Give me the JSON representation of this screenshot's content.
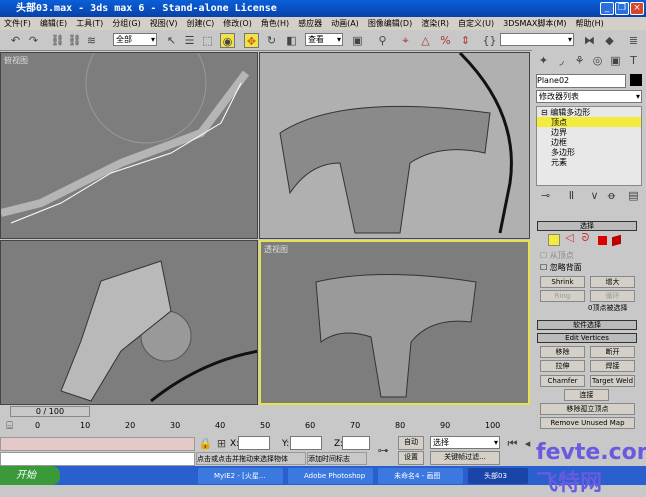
{
  "window": {
    "title": "头部03.max - 3ds max 6 - Stand-alone License"
  },
  "menu": [
    "文件(F)",
    "编辑(E)",
    "工具(T)",
    "分组(G)",
    "视图(V)",
    "创建(C)",
    "修改(O)",
    "角色(H)",
    "感应器",
    "动画(A)",
    "图像编辑(D)",
    "渲染(R)",
    "自定义(U)",
    "3DSMAX脚本(M)",
    "帮助(H)"
  ],
  "toolbar": {
    "selection_filter": "全部",
    "coord_system": "查看",
    "named_selection": ""
  },
  "viewports": {
    "top_left": "俯视图",
    "bottom_right": "透视图"
  },
  "panel": {
    "object_name": "Plane02",
    "modifier_list": "修改器列表",
    "stack": [
      "编辑多边形",
      "顶点",
      "边界",
      "边框",
      "多边形",
      "元素"
    ],
    "selection_rollout": "选择",
    "by_vertex": "从顶点",
    "ignore_backfacing": "忽略背面",
    "shrink": "Shrink",
    "grow": "增大",
    "ring": "Ring",
    "loop": "循环",
    "selected_count": "0顶点被选择",
    "soft_selection": "软件选择",
    "edit_vertices": "Edit Vertices",
    "remove": "移除",
    "break": "断开",
    "extrude": "拉伸",
    "weld": "焊接",
    "chamfer": "Chamfer",
    "target_weld": "Target Weld",
    "connect": "连接",
    "remove_isolated": "移除孤立顶点",
    "remove_unused": "Remove Unused Map Verts"
  },
  "timeline": {
    "frame": "0 / 100",
    "ticks": [
      "0",
      "10",
      "20",
      "30",
      "40",
      "50",
      "60",
      "70",
      "80",
      "90",
      "100"
    ]
  },
  "status": {
    "x_label": "X:",
    "y_label": "Y:",
    "z_label": "Z:",
    "auto_key": "自动",
    "set_key": "设置",
    "key_mode": "选择",
    "key_filters": "关键帧过滤...",
    "prompt": "点击或点击并拖动来选择物体",
    "add_time_tag": "添加时间标志"
  },
  "taskbar": {
    "start": "开始",
    "items": [
      "MyIE2 - [火星...",
      "Adobe Photoshop",
      "未命名4 - 画图",
      "头部03"
    ]
  },
  "watermark": "fevte.com 飞特网"
}
